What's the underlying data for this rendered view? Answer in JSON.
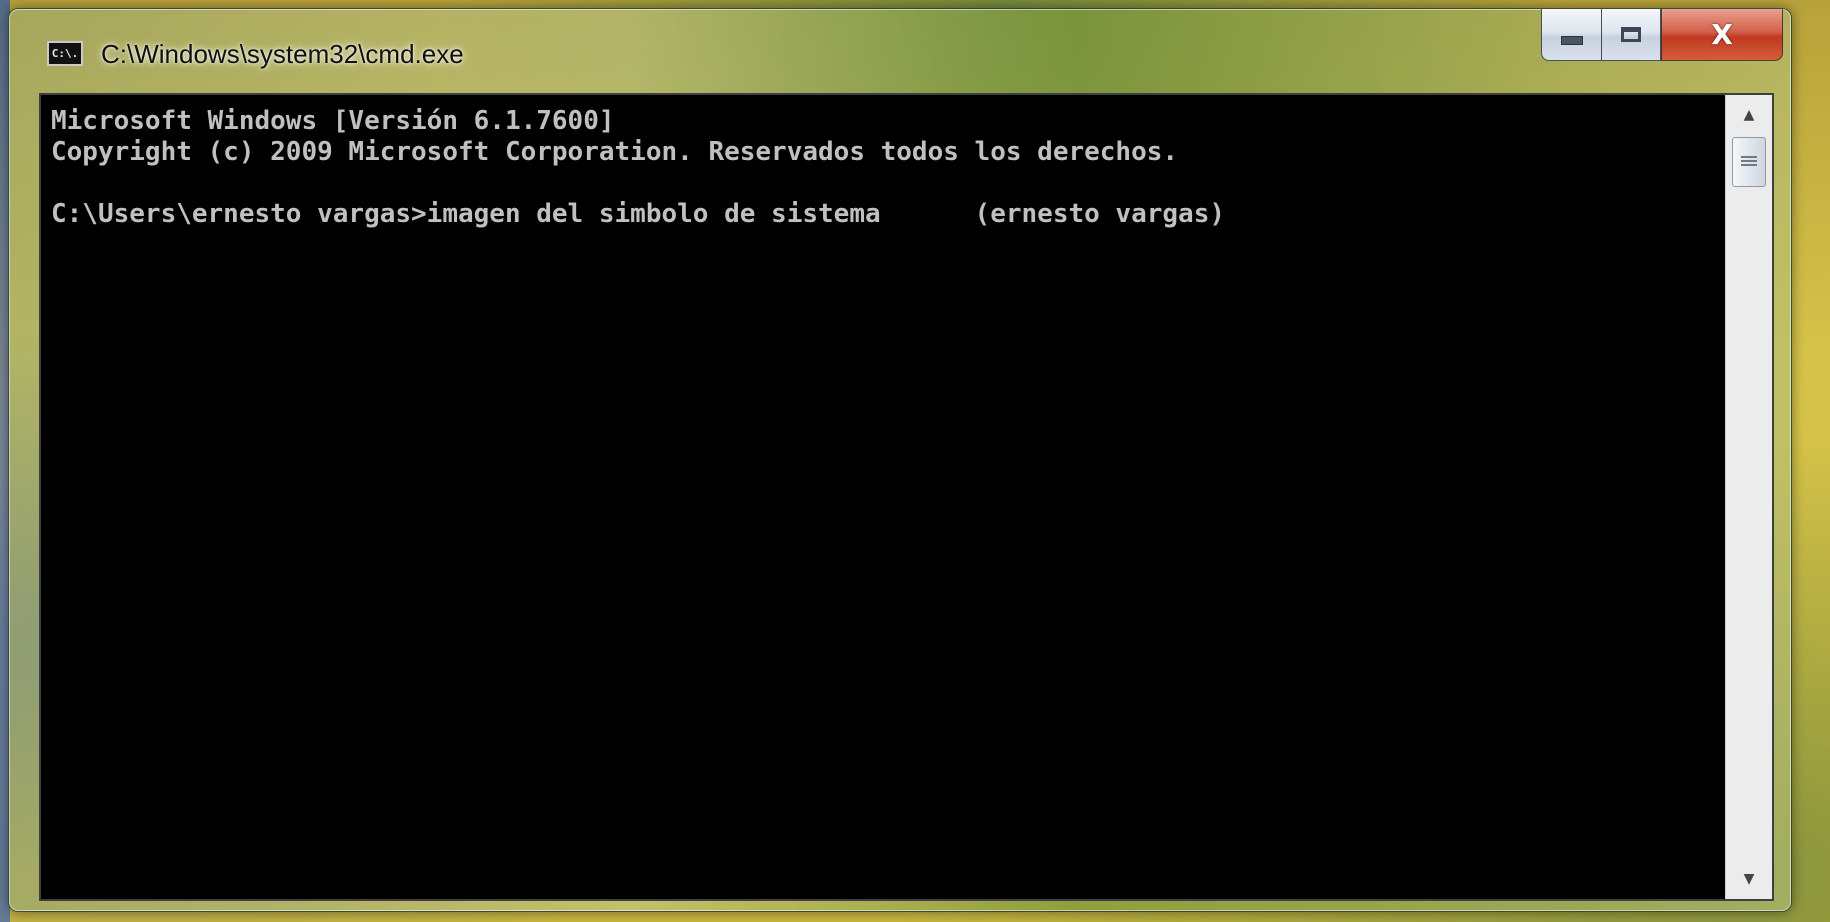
{
  "window": {
    "title": "C:\\Windows\\system32\\cmd.exe",
    "icon_label": "C:\\.",
    "close_glyph": "X"
  },
  "console": {
    "lines": [
      "Microsoft Windows [Versión 6.1.7600]",
      "Copyright (c) 2009 Microsoft Corporation. Reservados todos los derechos.",
      "",
      "C:\\Users\\ernesto vargas>imagen del simbolo de sistema      (ernesto vargas)"
    ]
  },
  "scrollbar": {
    "up_glyph": "▲",
    "down_glyph": "▼"
  },
  "colors": {
    "console_background": "#000000",
    "console_text": "#c0c0c0",
    "close_button": "#c9452c"
  },
  "icons": {
    "app": "cmd-icon",
    "minimize": "minimize-icon",
    "maximize": "maximize-icon",
    "close": "close-icon"
  }
}
